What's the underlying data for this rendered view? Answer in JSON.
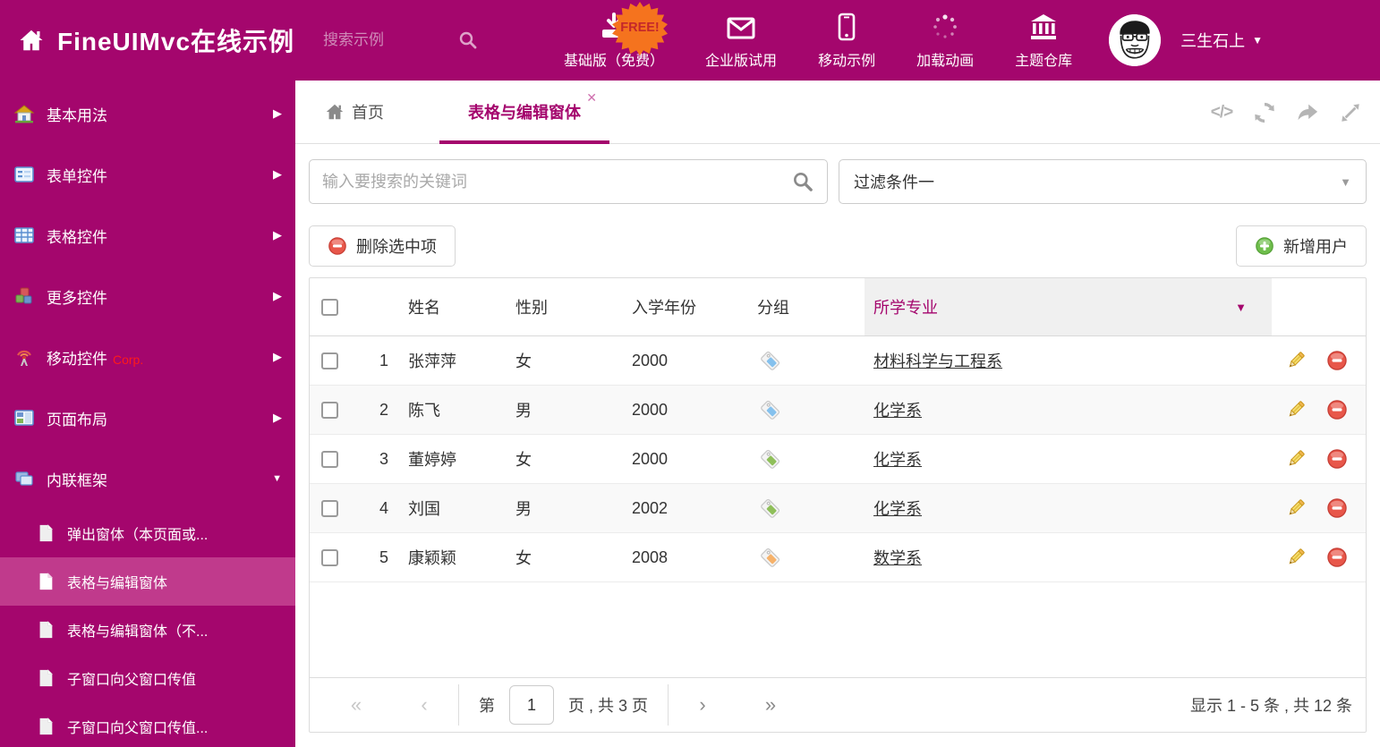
{
  "theme": {
    "primary": "#A4066D",
    "sidebar_selected": "#C03A8C",
    "free_badge_bg": "#F5731E",
    "free_badge_text": "#C3272B",
    "delete_red": "#E8574A",
    "add_green": "#6FBE4C",
    "tag_blue": "#85C1ED",
    "tag_green": "#8FBF5A",
    "tag_orange": "#F6B26B"
  },
  "header": {
    "title": "FineUIMvc在线示例",
    "search_placeholder": "搜索示例",
    "free_badge": "FREE!",
    "nav": [
      {
        "label": "基础版（免费）",
        "icon": "download-icon"
      },
      {
        "label": "企业版试用",
        "icon": "envelope-icon"
      },
      {
        "label": "移动示例",
        "icon": "mobile-icon"
      },
      {
        "label": "加载动画",
        "icon": "spinner-icon"
      },
      {
        "label": "主题仓库",
        "icon": "bank-icon"
      }
    ],
    "user_name": "三生石上"
  },
  "sidebar": {
    "items": [
      {
        "label": "基本用法",
        "icon": "house-icon"
      },
      {
        "label": "表单控件",
        "icon": "form-icon"
      },
      {
        "label": "表格控件",
        "icon": "table-icon"
      },
      {
        "label": "更多控件",
        "icon": "cubes-icon"
      },
      {
        "label": "移动控件",
        "badge": "Corp.",
        "icon": "antenna-icon"
      },
      {
        "label": "页面布局",
        "icon": "layout-icon"
      },
      {
        "label": "内联框架",
        "icon": "frames-icon",
        "expanded": true
      }
    ],
    "subitems": [
      {
        "label": "弹出窗体（本页面或..."
      },
      {
        "label": "表格与编辑窗体",
        "selected": true
      },
      {
        "label": "表格与编辑窗体（不..."
      },
      {
        "label": "子窗口向父窗口传值"
      },
      {
        "label": "子窗口向父窗口传值..."
      }
    ]
  },
  "tabs": {
    "home_label": "首页",
    "active_label": "表格与编辑窗体"
  },
  "filterbar": {
    "search_placeholder": "输入要搜索的关键词",
    "filter_value": "过滤条件一"
  },
  "toolbar": {
    "delete_label": "删除选中项",
    "add_label": "新增用户"
  },
  "table": {
    "headers": {
      "name": "姓名",
      "gender": "性别",
      "year": "入学年份",
      "group": "分组",
      "major": "所学专业"
    },
    "rows": [
      {
        "num": "1",
        "name": "张萍萍",
        "gender": "女",
        "year": "2000",
        "tag": "blue",
        "major": "材料科学与工程系"
      },
      {
        "num": "2",
        "name": "陈飞",
        "gender": "男",
        "year": "2000",
        "tag": "blue",
        "major": "化学系"
      },
      {
        "num": "3",
        "name": "董婷婷",
        "gender": "女",
        "year": "2000",
        "tag": "green",
        "major": "化学系"
      },
      {
        "num": "4",
        "name": "刘国",
        "gender": "男",
        "year": "2002",
        "tag": "green",
        "major": "化学系"
      },
      {
        "num": "5",
        "name": "康颖颖",
        "gender": "女",
        "year": "2008",
        "tag": "orange",
        "major": "数学系"
      }
    ]
  },
  "pagination": {
    "page_prefix": "第",
    "page_value": "1",
    "page_suffix": "页 , 共 3 页",
    "summary": "显示 1 - 5 条 , 共 12 条"
  }
}
